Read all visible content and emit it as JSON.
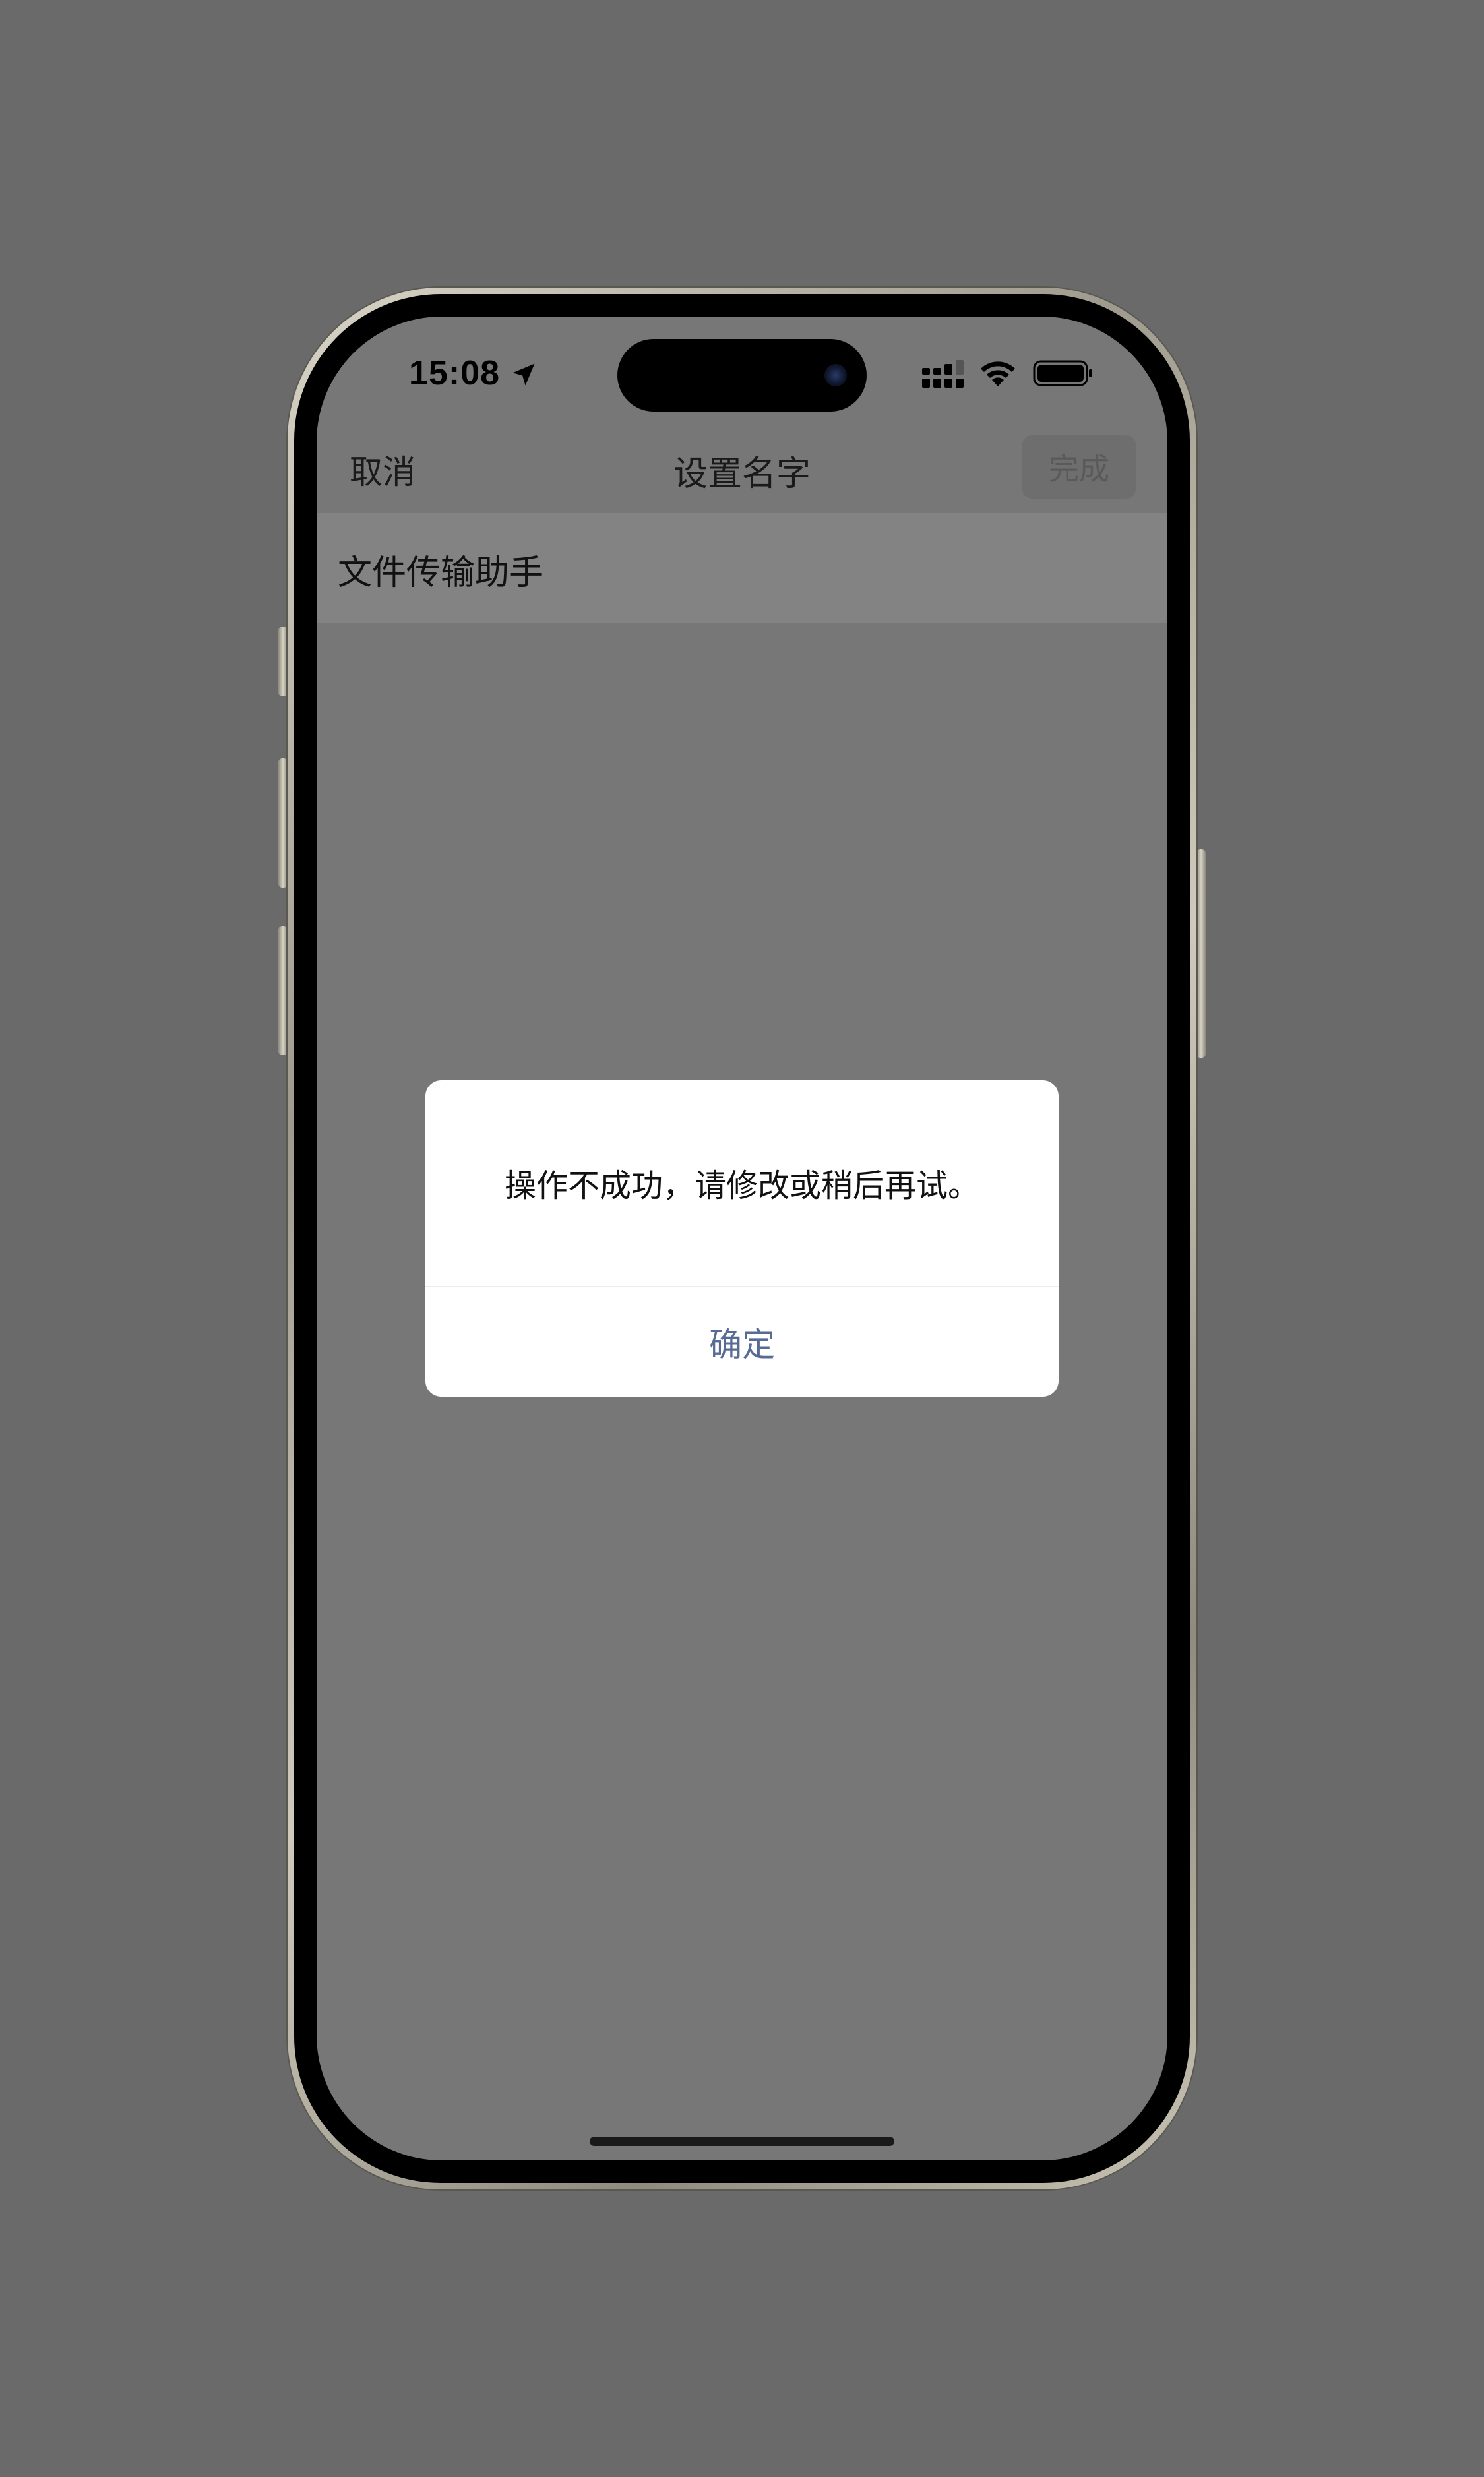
{
  "status_bar": {
    "time": "15:08",
    "location_icon": "location-arrow-icon",
    "signal_icon": "cellular-signal-icon",
    "wifi_icon": "wifi-icon",
    "battery_icon": "battery-icon"
  },
  "nav": {
    "cancel_label": "取消",
    "title": "设置名字",
    "done_label": "完成"
  },
  "name_field": {
    "value": "文件传输助手"
  },
  "alert": {
    "message": "操作不成功，请修改或稍后再试。",
    "confirm_label": "确定",
    "confirm_color": "#576b95"
  },
  "colors": {
    "background": "#6a6a6a",
    "screen_dimmed": "#777777"
  }
}
